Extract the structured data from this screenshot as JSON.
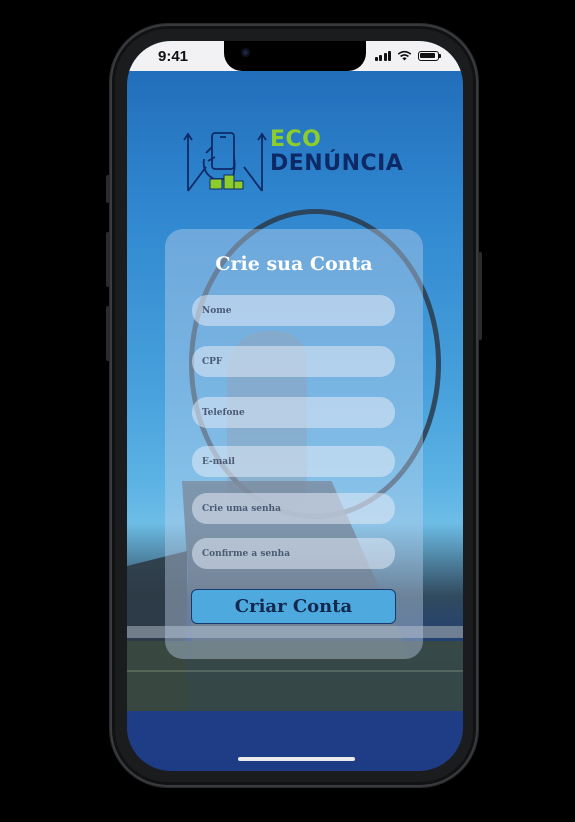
{
  "status_bar": {
    "time": "9:41"
  },
  "logo": {
    "line1": "ECO",
    "line2": "DENÚNCIA"
  },
  "form": {
    "title": "Crie sua Conta",
    "fields": [
      {
        "name": "nome",
        "placeholder": "Nome"
      },
      {
        "name": "cpf",
        "placeholder": "CPF"
      },
      {
        "name": "telefone",
        "placeholder": "Telefone"
      },
      {
        "name": "email",
        "placeholder": "E-mail"
      },
      {
        "name": "senha",
        "placeholder": "Crie uma senha"
      },
      {
        "name": "confirmar-senha",
        "placeholder": "Confirme a senha"
      }
    ],
    "submit_label": "Criar Conta"
  },
  "colors": {
    "logo_green": "#8ccd2b",
    "logo_navy": "#0e2a66",
    "button": "#4ea9df"
  },
  "icons": [
    "signal-icon",
    "wifi-icon",
    "battery-icon",
    "logo-icon"
  ]
}
